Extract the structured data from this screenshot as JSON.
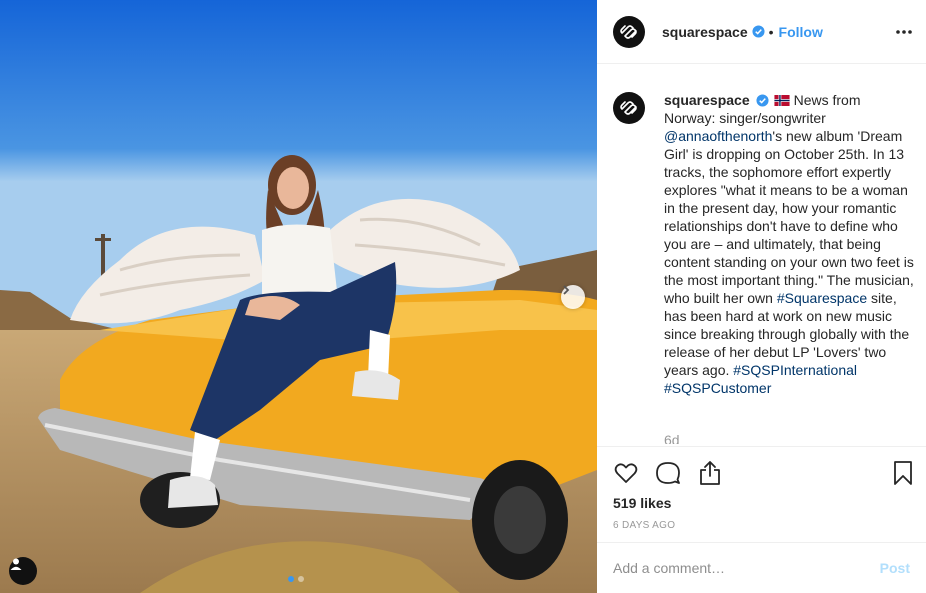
{
  "post": {
    "image_alt": "Woman with angel wings sitting on the hood of a wrecked yellow car",
    "carousel": {
      "total_slides": 2,
      "active_slide": 1
    }
  },
  "header": {
    "username": "squarespace",
    "separator": "•",
    "follow_label": "Follow",
    "more_icon": "more-horizontal-icon"
  },
  "caption": {
    "username": "squarespace",
    "flag_icon": "norway-flag-icon",
    "text_1": "News from Norway: singer/songwriter ",
    "mention": "@annaofthenorth",
    "text_2": "'s new album 'Dream Girl' is dropping on October 25th. In 13 tracks, the sophomore effort expertly explores \"what it means to be a woman in the present day, how your romantic relationships don't have to define who you are – and ultimately, that being content standing on your own two feet is the most important thing.\" The musician, who built her own ",
    "tag_1": "#Squarespace",
    "text_3": " site, has been hard at work on new music since breaking through globally with the release of her debut LP 'Lovers' two years ago.",
    "tag_2": "#SQSPInternational",
    "tag_3": "#SQSPCustomer",
    "time_ago": "6d"
  },
  "actions": {
    "like_icon": "heart-icon",
    "comment_icon": "comment-icon",
    "share_icon": "share-icon",
    "save_icon": "bookmark-icon",
    "likes": "519 likes",
    "date": "6 DAYS AGO"
  },
  "comment": {
    "placeholder": "Add a comment…",
    "post_label": "Post"
  },
  "colors": {
    "link_blue": "#3897f0",
    "hashtag": "#003569",
    "muted": "#999999",
    "post_disabled": "#b2dffc"
  }
}
